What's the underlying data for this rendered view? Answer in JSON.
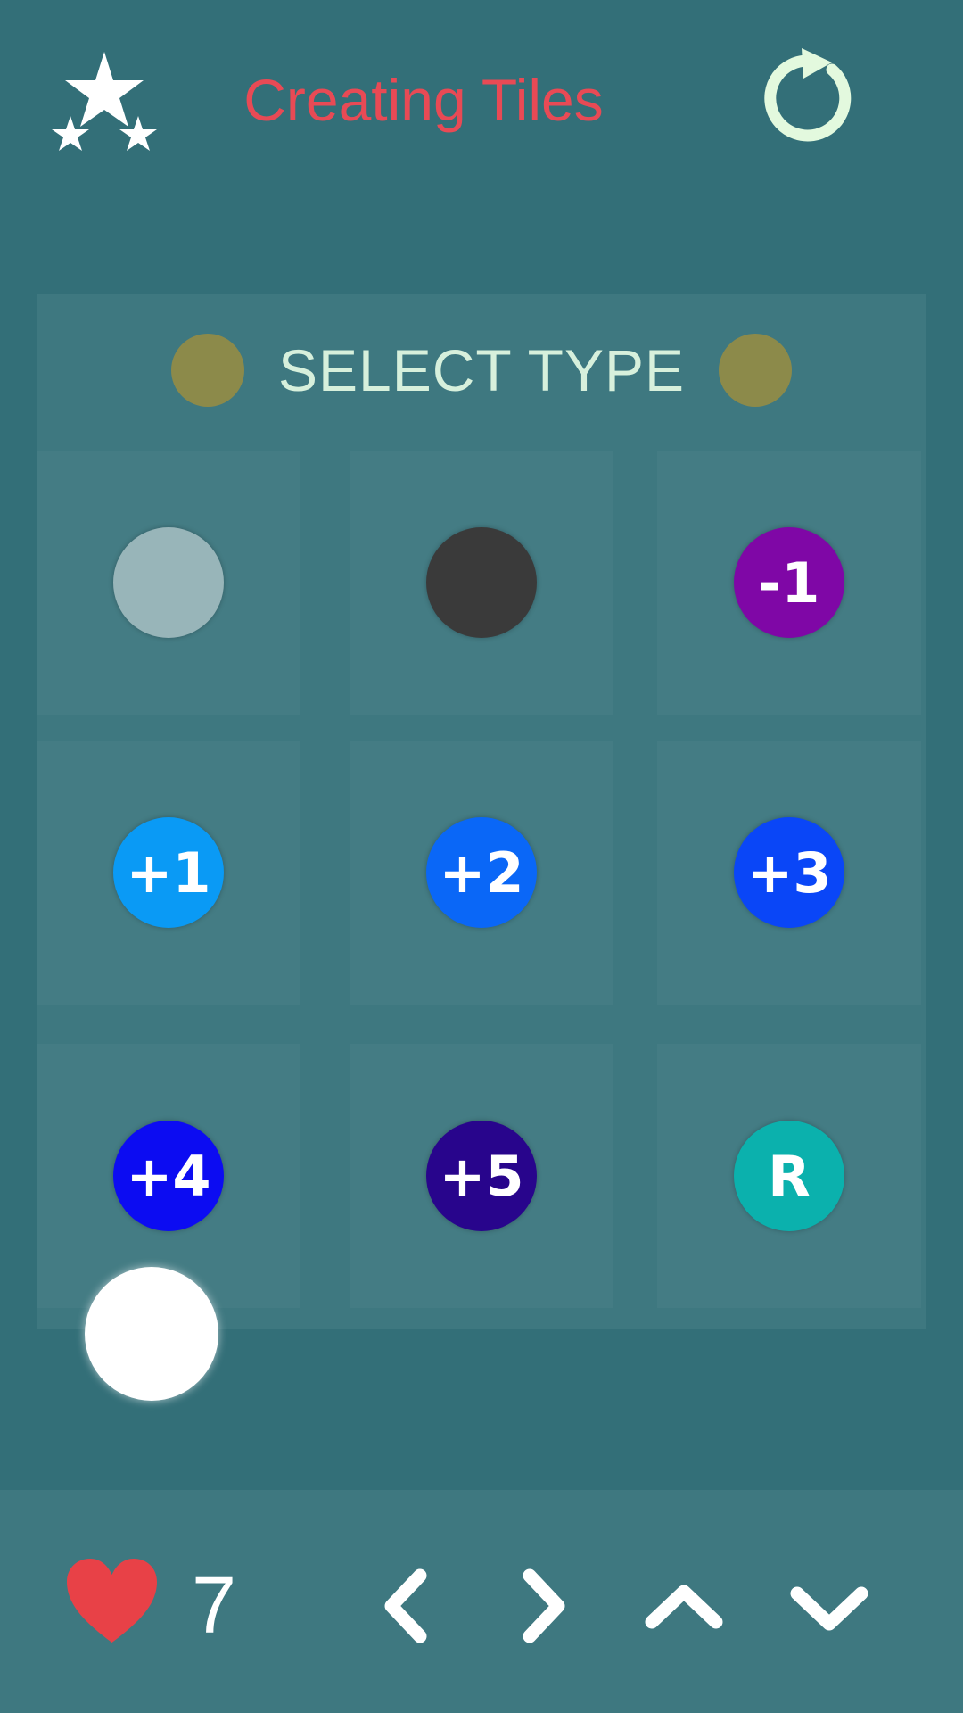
{
  "header": {
    "title": "Creating Tiles",
    "stars_icon": "stars-icon",
    "restart_icon": "restart-icon"
  },
  "panel": {
    "select_label": "SELECT TYPE",
    "tiles": [
      {
        "label": "",
        "type": "light-tile",
        "color": "#98b5b9"
      },
      {
        "label": "",
        "type": "dark-tile",
        "color": "#3a3a3a"
      },
      {
        "label": "-1",
        "type": "minus-one",
        "color": "#7f07a6"
      },
      {
        "label": "+1",
        "type": "plus-one",
        "color": "#0a9af5"
      },
      {
        "label": "+2",
        "type": "plus-two",
        "color": "#0a67f7"
      },
      {
        "label": "+3",
        "type": "plus-three",
        "color": "#0a46f7"
      },
      {
        "label": "+4",
        "type": "plus-four",
        "color": "#0c0cf2"
      },
      {
        "label": "+5",
        "type": "plus-five",
        "color": "#28058c"
      },
      {
        "label": "R",
        "type": "reset-tile",
        "color": "#0bb1ad"
      }
    ]
  },
  "footer": {
    "lives": "7",
    "heart_icon": "heart-icon",
    "nav_icons": [
      "chevron-left-icon",
      "chevron-right-icon",
      "chevron-up-icon",
      "chevron-down-icon"
    ]
  },
  "colors": {
    "background": "#336f78",
    "panel": "#3e7880",
    "title": "#e84a55",
    "select_label": "#d7f0dc",
    "gold_dot": "#8c8a4a",
    "heart": "#e84147",
    "restart": "#e3f9de"
  }
}
